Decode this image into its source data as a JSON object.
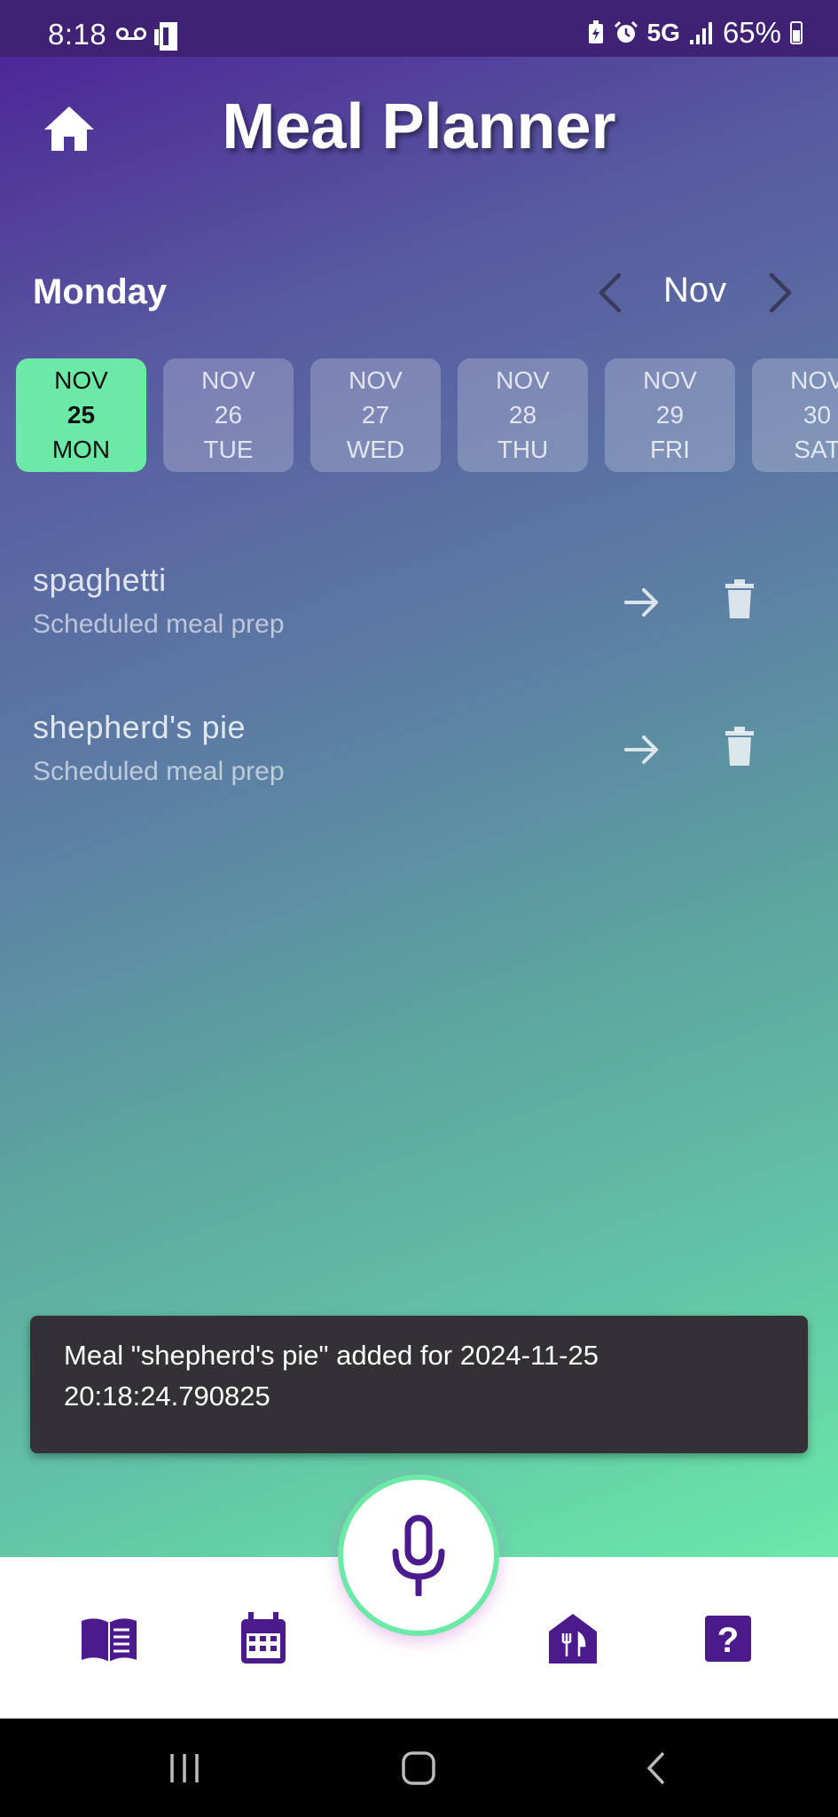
{
  "status_bar": {
    "time": "8:18",
    "network": "5G",
    "battery": "65%"
  },
  "header": {
    "title": "Meal Planner",
    "home_icon": "home-icon"
  },
  "day_nav": {
    "day": "Monday",
    "month": "Nov",
    "prev_icon": "chevron-left-icon",
    "next_icon": "chevron-right-icon"
  },
  "dates": [
    {
      "month": "NOV",
      "day": "25",
      "weekday": "MON",
      "selected": true
    },
    {
      "month": "NOV",
      "day": "26",
      "weekday": "TUE",
      "selected": false
    },
    {
      "month": "NOV",
      "day": "27",
      "weekday": "WED",
      "selected": false
    },
    {
      "month": "NOV",
      "day": "28",
      "weekday": "THU",
      "selected": false
    },
    {
      "month": "NOV",
      "day": "29",
      "weekday": "FRI",
      "selected": false
    },
    {
      "month": "NOV",
      "day": "30",
      "weekday": "SAT",
      "selected": false
    }
  ],
  "meals": [
    {
      "name": "spaghetti",
      "subtitle": "Scheduled meal prep"
    },
    {
      "name": "shepherd's pie",
      "subtitle": "Scheduled meal prep"
    }
  ],
  "snackbar": {
    "line1": "Meal \"shepherd's pie\" added for 2024-11-25",
    "line2": "20:18:24.790825"
  },
  "bottom_nav": {
    "items": [
      "recipe-book-icon",
      "calendar-icon",
      "mic-icon",
      "restaurant-icon",
      "help-icon"
    ]
  },
  "colors": {
    "accent_green": "#6de9a7",
    "brand_purple": "#4b1a8c",
    "snackbar_bg": "#333136"
  }
}
